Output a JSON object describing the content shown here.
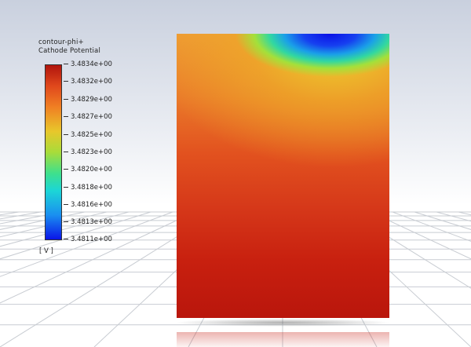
{
  "legend": {
    "title_line1": "contour-phi+",
    "title_line2": "Cathode Potential",
    "labels": [
      "3.4834e+00",
      "3.4832e+00",
      "3.4829e+00",
      "3.4827e+00",
      "3.4825e+00",
      "3.4823e+00",
      "3.4820e+00",
      "3.4818e+00",
      "3.4816e+00",
      "3.4813e+00",
      "3.4811e+00"
    ],
    "unit": "[ V ]",
    "colormap": [
      "#b0140d",
      "#e0481c",
      "#f07f23",
      "#e8c72b",
      "#a8dc3a",
      "#3fe08c",
      "#1cd6d6",
      "#1a8ff0",
      "#0a14e8"
    ]
  },
  "scene": {
    "background_top": "#c9d0de",
    "floor_grid_color": "#c8ccd2",
    "contour_min_color": "#0a10e6",
    "contour_max_color": "#b9160c"
  }
}
